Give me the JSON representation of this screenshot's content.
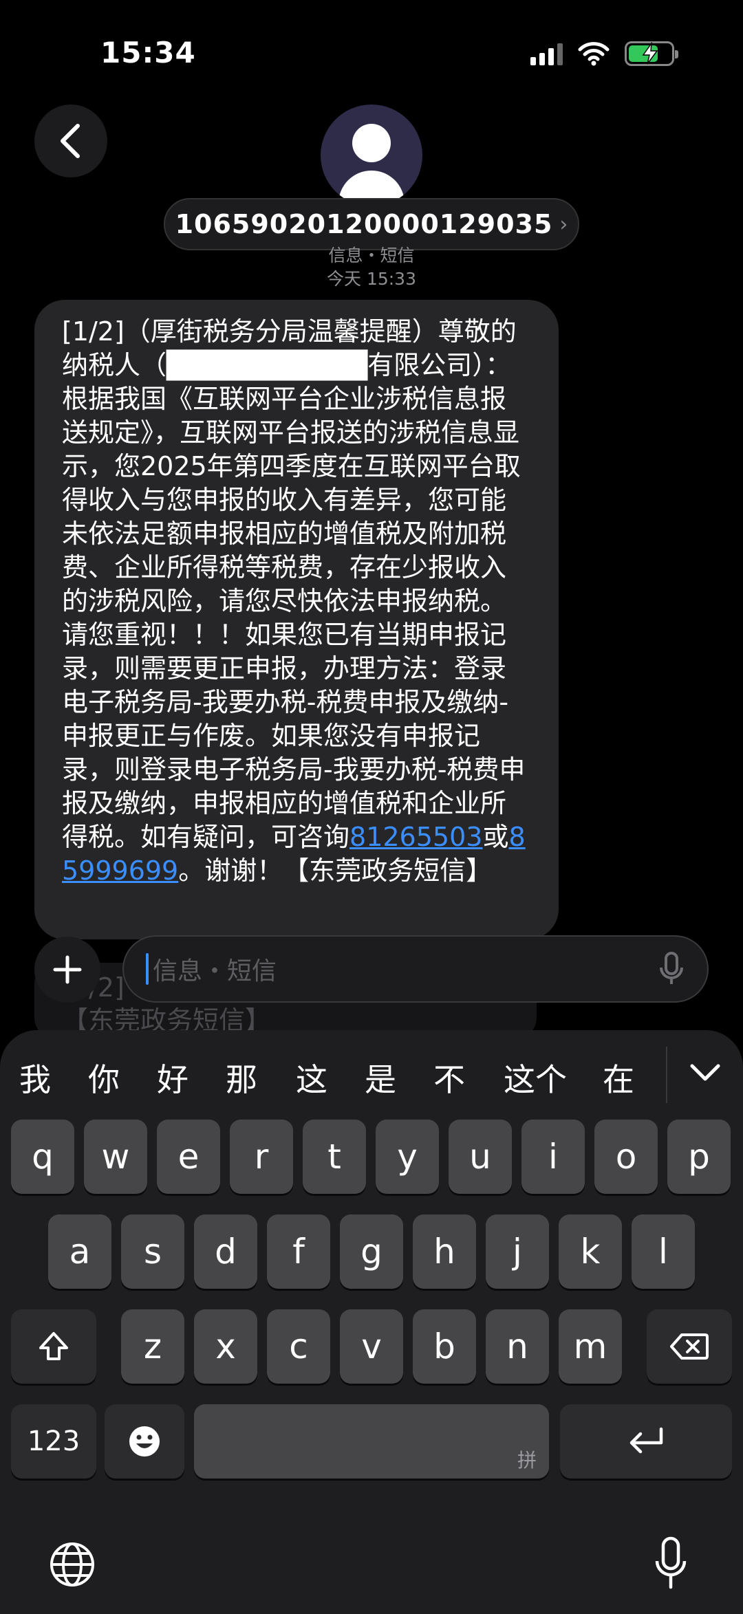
{
  "status_bar": {
    "time": "15:34"
  },
  "contact": {
    "number": "10659020120000129035",
    "chevron": "›"
  },
  "meta": {
    "service": "信息・短信",
    "timestamp": "今天 15:33"
  },
  "message": {
    "text_before": "[1/2]（厚街税务分局温馨提醒）尊敬的纳税人（██████████有限公司）：根据我国《互联网平台企业涉税信息报送规定》，互联网平台报送的涉税信息显示，您2025年第四季度在互联网平台取得收入与您申报的收入有差异，您可能未依法足额申报相应的增值税及附加税费、企业所得税等税费，存在少报收入的涉税风险，请您尽快依法申报纳税。请您重视！！！如果您已有当期申报记录，则需要更正申报，办理方法：登录电子税务局-我要办税-税费申报及缴纳-申报更正与作废。如果您没有申报记录，则登录电子税务局-我要办税-税费申报及缴纳，申报相应的增值税和企业所得税。如有疑问，可咨询",
    "phone1": "81265503",
    "or": "或",
    "phone2": "85999699",
    "text_after": "。谢谢！【东莞政务短信】"
  },
  "ghost_message": {
    "text": "[2/2]（厚街税务分局）【东莞政务】【东莞政务短信】"
  },
  "compose": {
    "placeholder": "信息・短信"
  },
  "keyboard": {
    "candidates": [
      "我",
      "你",
      "好",
      "那",
      "这",
      "是",
      "不",
      "这个",
      "在"
    ],
    "row1": [
      "q",
      "w",
      "e",
      "r",
      "t",
      "y",
      "u",
      "i",
      "o",
      "p"
    ],
    "row2": [
      "a",
      "s",
      "d",
      "f",
      "g",
      "h",
      "j",
      "k",
      "l"
    ],
    "row3": [
      "z",
      "x",
      "c",
      "v",
      "b",
      "n",
      "m"
    ],
    "num_label": "123",
    "space_sub": "拼"
  }
}
